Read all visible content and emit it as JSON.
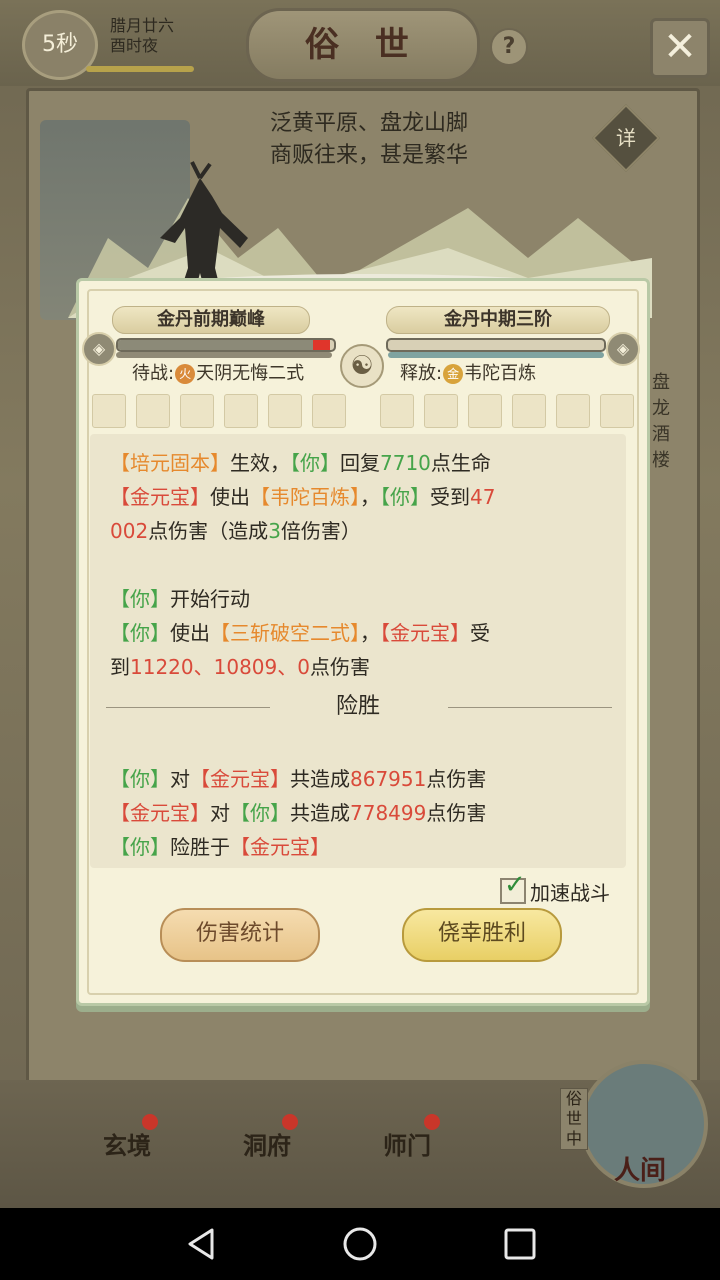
{
  "header": {
    "timer": "5秒",
    "date_line1": "腊月廿六",
    "date_line2": "酉时夜",
    "title": "俗 世",
    "help_label": "?",
    "close_label": "✕"
  },
  "location": {
    "line1": "泛黄平原、盘龙山脚",
    "line2": "商贩往来，甚是繁华",
    "detail_label": "详"
  },
  "background": {
    "side_text": "盘 龙 酒 楼"
  },
  "battle": {
    "player": {
      "realm": "金丹前期巅峰",
      "hp_fraction": 0.98,
      "status_label": "待战:",
      "element": "火",
      "skill": "天阴无悔二式"
    },
    "enemy": {
      "realm": "金丹中期三阶",
      "hp_fraction": 0.0,
      "status_label": "释放:",
      "element": "金",
      "skill": "韦陀百炼"
    },
    "taiji": "☯"
  },
  "log": {
    "line1": [
      {
        "t": "【培元固本】",
        "c": "orange"
      },
      {
        "t": "生效，",
        "c": "black"
      },
      {
        "t": "【你】",
        "c": "green"
      },
      {
        "t": "回复",
        "c": "black"
      },
      {
        "t": "7710",
        "c": "green"
      },
      {
        "t": "点生命",
        "c": "black"
      }
    ],
    "line2": [
      {
        "t": "【金元宝】",
        "c": "red"
      },
      {
        "t": "使出",
        "c": "black"
      },
      {
        "t": "【韦陀百炼】",
        "c": "orange"
      },
      {
        "t": "，",
        "c": "black"
      },
      {
        "t": "【你】",
        "c": "green"
      },
      {
        "t": "受到",
        "c": "black"
      },
      {
        "t": "47",
        "c": "red"
      }
    ],
    "line3": [
      {
        "t": "002",
        "c": "red"
      },
      {
        "t": "点伤害（造成",
        "c": "black"
      },
      {
        "t": "3",
        "c": "green"
      },
      {
        "t": "倍伤害）",
        "c": "black"
      }
    ],
    "line4": [
      {
        "t": "【你】",
        "c": "green"
      },
      {
        "t": "开始行动",
        "c": "black"
      }
    ],
    "line5": [
      {
        "t": "【你】",
        "c": "green"
      },
      {
        "t": "使出",
        "c": "black"
      },
      {
        "t": "【三斩破空二式】",
        "c": "orange"
      },
      {
        "t": "，",
        "c": "black"
      },
      {
        "t": "【金元宝】",
        "c": "red"
      },
      {
        "t": "受",
        "c": "black"
      }
    ],
    "line6": [
      {
        "t": "到",
        "c": "black"
      },
      {
        "t": "11220、10809、0",
        "c": "red"
      },
      {
        "t": "点伤害",
        "c": "black"
      }
    ],
    "outcome": "险胜",
    "line7": [
      {
        "t": "【你】",
        "c": "green"
      },
      {
        "t": "对",
        "c": "black"
      },
      {
        "t": "【金元宝】",
        "c": "red"
      },
      {
        "t": "共造成",
        "c": "black"
      },
      {
        "t": "867951",
        "c": "red"
      },
      {
        "t": "点伤害",
        "c": "black"
      }
    ],
    "line8": [
      {
        "t": "【金元宝】",
        "c": "red"
      },
      {
        "t": "对",
        "c": "black"
      },
      {
        "t": "【你】",
        "c": "green"
      },
      {
        "t": "共造成",
        "c": "black"
      },
      {
        "t": "778499",
        "c": "red"
      },
      {
        "t": "点伤害",
        "c": "black"
      }
    ],
    "line9": [
      {
        "t": "【你】",
        "c": "green"
      },
      {
        "t": "险胜于",
        "c": "black"
      },
      {
        "t": "【金元宝】",
        "c": "red"
      }
    ]
  },
  "controls": {
    "speed_label": "加速战斗",
    "speed_checked": true,
    "stats_button": "伤害统计",
    "victory_button": "侥幸胜利"
  },
  "bottom_nav": {
    "items": [
      "玄境",
      "洞府",
      "师门"
    ],
    "world_label": "人间",
    "world_tag": "俗世中"
  },
  "colors": {
    "orange": "#e6892d",
    "green": "#46a44a",
    "red": "#d94a3a",
    "hp_player": "#8c8a78",
    "hp_accent": "#e0352b"
  },
  "icons": {
    "close": "close-icon",
    "help": "help-icon",
    "taiji": "taiji-icon",
    "check": "checkmark-icon"
  }
}
